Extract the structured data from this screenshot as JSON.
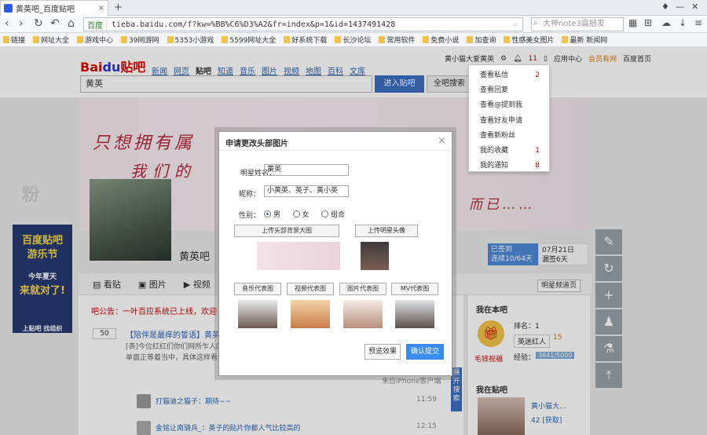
{
  "browser": {
    "tab_title": "黄英吧_百度贴吧",
    "tab_close": "×",
    "new_tab": "+",
    "url_host": "百度",
    "url": "tieba.baidu.com/f?kw=%BB%C6%D3%A2&fr=index&p=1&id=1437491428",
    "search_placeholder": "大神note3震撼发",
    "bookmarks": [
      "链接",
      "网址大全",
      "游戏中心",
      "39网游网",
      "5353小游戏",
      "5599网址大全",
      "好系统下载",
      "长沙论坛",
      "常用软件",
      "免费小说",
      "加查询",
      "性感美女图片",
      "最新 新闻网"
    ]
  },
  "tieba": {
    "logo_text": "Bai",
    "logo_du": "du",
    "logo_suffix": "贴吧",
    "nav": [
      "新闻",
      "网页",
      "贴吧",
      "知道",
      "音乐",
      "图片",
      "视频",
      "地图",
      "百科",
      "文库"
    ],
    "nav_current": "贴吧",
    "search_value": "黄英",
    "enter_button": "进入贴吧",
    "all_search_button": "全吧搜索",
    "username": "黄小猫大爱黄英",
    "msg_badge": "11",
    "app_center": "应用中心",
    "vip": "会员有网",
    "home": "百度首页"
  },
  "dropdown": {
    "items": [
      {
        "label": "查看私信",
        "count": "2"
      },
      {
        "label": "查看回复",
        "count": ""
      },
      {
        "label": "查看@提到我",
        "count": ""
      },
      {
        "label": "查看好友申请",
        "count": ""
      },
      {
        "label": "查看新粉丝",
        "count": ""
      },
      {
        "label": "我的收藏",
        "count": "1"
      },
      {
        "label": "我的通知",
        "count": "8"
      }
    ]
  },
  "banner": {
    "slogan1": "只想拥有属",
    "slogan2": "我们的",
    "slogan3": "而已……",
    "bar_name": "黄英吧",
    "signed": "已签到",
    "signed_rank": "连续10/64天",
    "date": "07月21日",
    "date_sub": "漏签6天"
  },
  "tabs": {
    "items": [
      "看贴",
      "图片",
      "视频"
    ],
    "star_page": "明星频道页"
  },
  "notice": "吧公告：一叶百应系统已上线，欢迎",
  "threads": {
    "reply_count": "50",
    "title": "【陪伴是最痒的誓语】黄英吧",
    "excerpt1": "[表]今位红红们你们网所乍人的撑",
    "excerpt2": "单面正等着当中，具体这样看本面",
    "from_iphone": "来自iPhone客户端",
    "row2_user": "打猫迪之猫子：期待~~",
    "row2_time": "11:59",
    "row3_user": "金铭让南骑兵_：英子的贴片你都人气比较高的",
    "row3_time": "12:15"
  },
  "sidebar": {
    "my_bar": "我在本吧",
    "rank": "排名：1",
    "title": "英迷红人",
    "level": "15",
    "exp_label": "经验：",
    "exp_value": "3641/5000",
    "sign_label": "毛钱祝福",
    "in_bar": "我在贴吧",
    "user": "黄小猫大...",
    "score": "42 [获取]"
  },
  "ad": {
    "line1": "百度贴吧",
    "line2": "游乐节",
    "line3": "今年夏天",
    "line4": "来就对了!",
    "line5": "上贴吧 找组织"
  },
  "side_pill": "展开搜索",
  "watermark": "粉",
  "modal": {
    "title": "申请更改头部图片",
    "close": "×",
    "star_name_label": "明星姓名：",
    "star_name_value": "黄英",
    "nickname_label": "昵称：",
    "nickname_value": "小黄英、英子、黄小英",
    "gender_label": "性别：",
    "gender_options": [
      "男",
      "女",
      "组合"
    ],
    "gender_selected": "男",
    "upload_bg": "上传头部背景大图",
    "upload_avatar": "上传明星头像",
    "rep_buttons": [
      "音乐代表图",
      "视频代表图",
      "图片代表图",
      "MV代表图"
    ],
    "preview": "预览效果",
    "submit": "确认提交"
  },
  "colors": {
    "accent": "#3a6ec2",
    "submit": "#3b8cf0",
    "slogan": "#b5283c",
    "baidu_red": "#e10601",
    "baidu_blue": "#2932e1"
  }
}
